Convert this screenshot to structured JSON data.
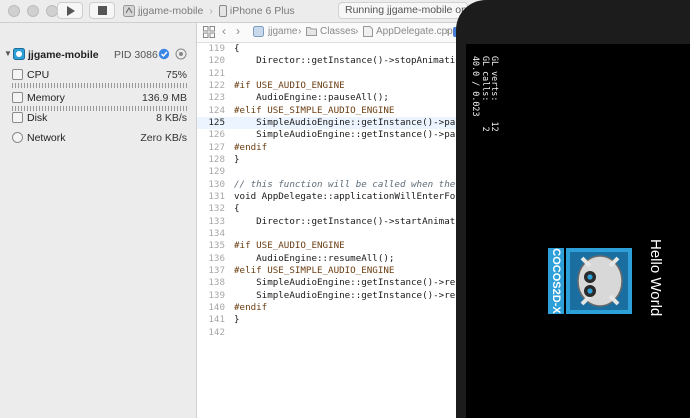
{
  "toolbar": {
    "scheme_app": "jjgame-mobile",
    "scheme_device": "iPhone 6 Plus",
    "status": "Running jjgame-mobile on iPhone"
  },
  "debug_navigator": {
    "process_name": "jjgame-mobile",
    "pid": "PID 3086",
    "gauges": [
      {
        "label": "CPU",
        "value": "75%"
      },
      {
        "label": "Memory",
        "value": "136.9 MB"
      },
      {
        "label": "Disk",
        "value": "8 KB/s"
      },
      {
        "label": "Network",
        "value": "Zero KB/s"
      }
    ]
  },
  "jump_bar": {
    "project": "jjgame",
    "folder": "Classes",
    "file": "AppDelegate.cpp"
  },
  "code": {
    "lines": [
      {
        "num": "119",
        "text": "{"
      },
      {
        "num": "120",
        "text": "    Director::getInstance()->stopAnimatio"
      },
      {
        "num": "121",
        "text": ""
      },
      {
        "num": "122",
        "text": "#if USE_AUDIO_ENGINE"
      },
      {
        "num": "123",
        "text": "    AudioEngine::pauseAll();"
      },
      {
        "num": "124",
        "text": "#elif USE_SIMPLE_AUDIO_ENGINE"
      },
      {
        "num": "125",
        "text": "    SimpleAudioEngine::getInstance()->pau"
      },
      {
        "num": "126",
        "text": "    SimpleAudioEngine::getInstance()->pau"
      },
      {
        "num": "127",
        "text": "#endif"
      },
      {
        "num": "128",
        "text": "}"
      },
      {
        "num": "129",
        "text": ""
      },
      {
        "num": "130",
        "text": "// this function will be called when the a"
      },
      {
        "num": "131",
        "text": "void AppDelegate::applicationWillEnterFore"
      },
      {
        "num": "132",
        "text": "{"
      },
      {
        "num": "133",
        "text": "    Director::getInstance()->startAnimati"
      },
      {
        "num": "134",
        "text": ""
      },
      {
        "num": "135",
        "text": "#if USE_AUDIO_ENGINE"
      },
      {
        "num": "136",
        "text": "    AudioEngine::resumeAll();"
      },
      {
        "num": "137",
        "text": "#elif USE_SIMPLE_AUDIO_ENGINE"
      },
      {
        "num": "138",
        "text": "    SimpleAudioEngine::getInstance()->resu"
      },
      {
        "num": "139",
        "text": "    SimpleAudioEngine::getInstance()->resu"
      },
      {
        "num": "140",
        "text": "#endif"
      },
      {
        "num": "141",
        "text": "}"
      },
      {
        "num": "142",
        "text": ""
      }
    ]
  },
  "simulator": {
    "stats": "GL verts:    12\nGL calls:     2\n40.0 / 0.023",
    "hello_text": "Hello World",
    "logo_text": "COCOS2D-X"
  },
  "colors": {
    "preprocessor": "#6b3e12",
    "keyword": "#9b2393",
    "comment": "#5d6c79",
    "current_line": "#ecf5ff",
    "cocos_blue": "#2d9fd9"
  }
}
